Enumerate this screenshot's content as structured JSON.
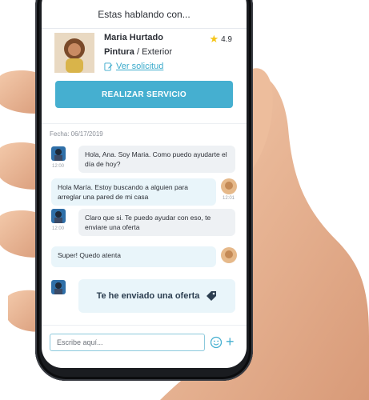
{
  "header": {
    "title": "Estas hablando con..."
  },
  "profile": {
    "name": "Maria Hurtado",
    "service_main": "Pintura",
    "service_separator": " / ",
    "service_sub": "Exterior",
    "request_link": "Ver solicitud",
    "rating": "4.9"
  },
  "cta": {
    "label": "REALIZAR SERVICIO"
  },
  "chat": {
    "date_label": "Fecha: 06/17/2019",
    "messages": [
      {
        "text": "Hola, Ana. Soy Maria. Como puedo ayudarte el día de hoy?",
        "time": "12:00"
      },
      {
        "text": "Hola María. Estoy buscando a alguien para arreglar una pared de mi casa",
        "time": "12:01"
      },
      {
        "text": "Claro que si. Te puedo ayudar con eso, te enviare una oferta",
        "time": "12:00"
      },
      {
        "text": "Super! Quedo atenta"
      }
    ],
    "offer_label": "Te he enviado una oferta"
  },
  "composer": {
    "placeholder": "Escribe aquí..."
  },
  "colors": {
    "accent": "#45afd0",
    "star": "#f5c518",
    "text": "#2c2f36"
  }
}
